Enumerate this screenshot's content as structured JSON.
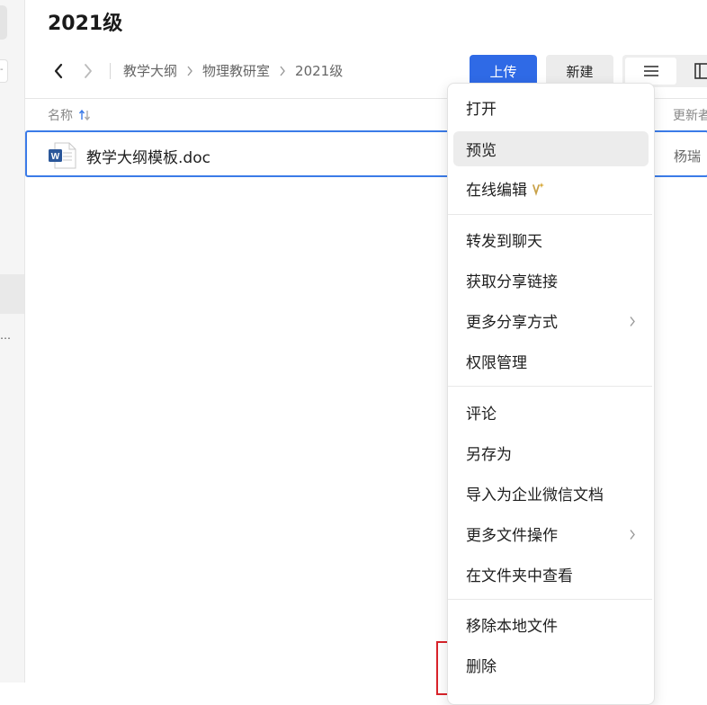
{
  "page": {
    "title": "2021级"
  },
  "breadcrumb": [
    "教学大纲",
    "物理教研室",
    "2021级"
  ],
  "toolbar": {
    "upload_label": "上传",
    "new_label": "新建"
  },
  "columns": {
    "name": "名称",
    "updater": "更新者"
  },
  "files": [
    {
      "name": "教学大纲模板.doc",
      "updater": "杨瑞"
    }
  ],
  "context_menu": {
    "items": [
      {
        "label": "打开"
      },
      {
        "label": "预览"
      },
      {
        "label": "在线编辑"
      },
      {
        "label": "转发到聊天"
      },
      {
        "label": "获取分享链接"
      },
      {
        "label": "更多分享方式"
      },
      {
        "label": "权限管理"
      },
      {
        "label": "评论"
      },
      {
        "label": "另存为"
      },
      {
        "label": "导入为企业微信文档"
      },
      {
        "label": "更多文件操作"
      },
      {
        "label": "在文件夹中查看"
      },
      {
        "label": "移除本地文件"
      },
      {
        "label": "删除"
      }
    ]
  },
  "colors": {
    "accent": "#2f6ae6",
    "highlight_box": "#d9232a",
    "word_icon": "#2b579a"
  }
}
